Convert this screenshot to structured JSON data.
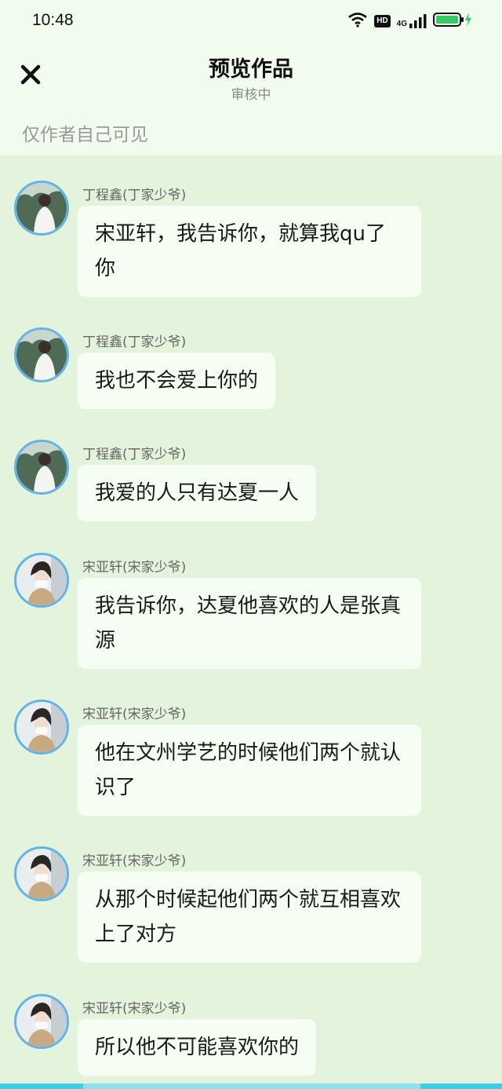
{
  "status_bar": {
    "time": "10:48",
    "hd": "HD",
    "network": "4G"
  },
  "header": {
    "title": "预览作品",
    "subtitle": "审核中",
    "visibility_note": "仅作者自己可见"
  },
  "messages": [
    {
      "sender": "丁程鑫(丁家少爷)",
      "text": "宋亚轩，我告诉你，就算我qu了你"
    },
    {
      "sender": "丁程鑫(丁家少爷)",
      "text": "我也不会爱上你的"
    },
    {
      "sender": "丁程鑫(丁家少爷)",
      "text": "我爱的人只有达夏一人"
    },
    {
      "sender": "宋亚轩(宋家少爷)",
      "text": "我告诉你，达夏他喜欢的人是张真源"
    },
    {
      "sender": "宋亚轩(宋家少爷)",
      "text": "他在文州学艺的时候他们两个就认识了"
    },
    {
      "sender": "宋亚轩(宋家少爷)",
      "text": "从那个时候起他们两个就互相喜欢上了对方"
    },
    {
      "sender": "宋亚轩(宋家少爷)",
      "text": "所以他不可能喜欢你的"
    }
  ],
  "colors": {
    "chat_background": "#e3f3dc",
    "header_background": "#f1fcef",
    "bubble_background": "#f6fef3",
    "avatar_ring": "#61b4ea",
    "battery_green": "#35c864"
  }
}
